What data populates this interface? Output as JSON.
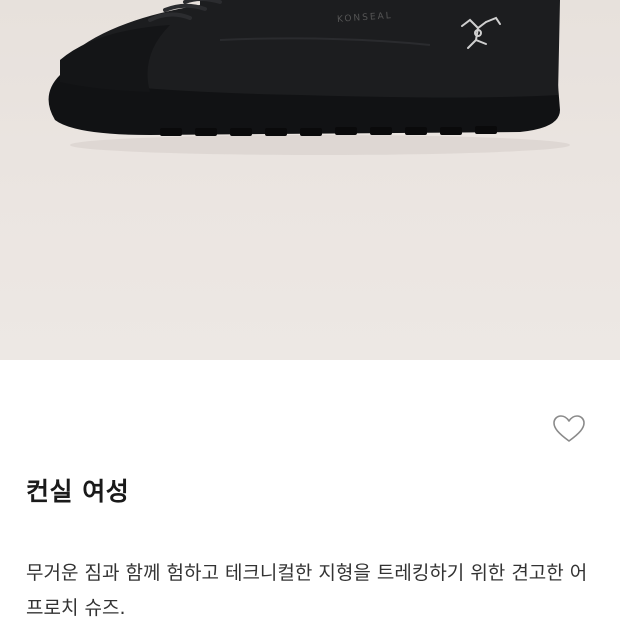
{
  "product": {
    "image_alt": "Arc'teryx Konseal approach shoe, black",
    "brand_mark_text": "KONSEAL",
    "name": "컨실 여성",
    "description": "무거운 짐과 함께 험하고 테크니컬한 지형을 트레킹하기 위한 견고한 어프로치 슈즈.",
    "wishlist_icon": "heart-outline-icon"
  },
  "colors": {
    "image_bg": "#e9e3df",
    "shoe": "#1c1d1f",
    "title_text": "#1a1a1a",
    "body_text": "#333333",
    "icon_stroke": "#8a8a8a"
  }
}
